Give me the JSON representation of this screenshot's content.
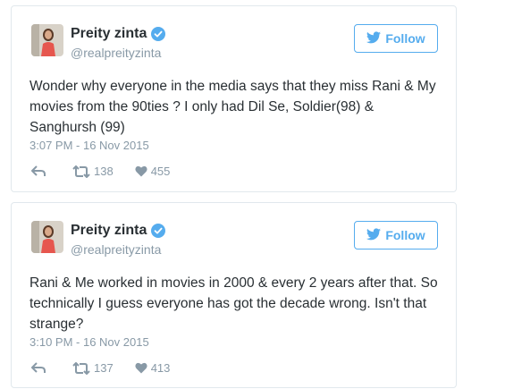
{
  "tweets": [
    {
      "author": {
        "name": "Preity zinta",
        "handle": "@realpreityzinta",
        "verified": true
      },
      "follow_label": "Follow",
      "text": "Wonder why everyone in the media says that they miss Rani & My movies from the 90ties ? I only had Dil Se, Soldier(98) & Sanghursh (99)",
      "timestamp": "3:07 PM - 16 Nov 2015",
      "retweets": "138",
      "likes": "455"
    },
    {
      "author": {
        "name": "Preity zinta",
        "handle": "@realpreityzinta",
        "verified": true
      },
      "follow_label": "Follow",
      "text": "Rani & Me worked in movies in 2000 & every 2 years after that. So technically I guess everyone has got the decade wrong. Isn't that strange?",
      "timestamp": "3:10 PM - 16 Nov 2015",
      "retweets": "137",
      "likes": "413"
    }
  ],
  "colors": {
    "accent": "#55acee",
    "verified": "#55acee",
    "muted": "#8899a6",
    "text": "#292f33"
  },
  "icons": [
    "verified-icon",
    "twitter-bird-icon",
    "reply-icon",
    "retweet-icon",
    "heart-icon"
  ]
}
